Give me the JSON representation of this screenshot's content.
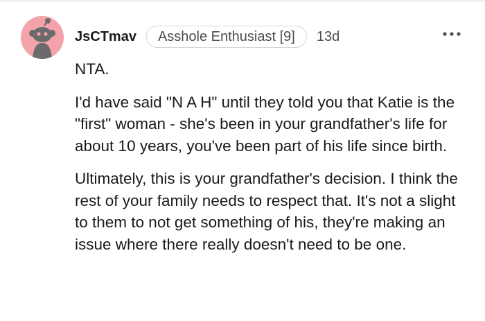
{
  "comment": {
    "username": "JsCTmav",
    "flair": "Asshole Enthusiast [9]",
    "timestamp": "13d",
    "more_label": "•••",
    "avatar_icon": "snoo-avatar-icon",
    "avatar_color": "#f4a3aa",
    "paragraphs": [
      "NTA.",
      "I'd have said \"N A H\" until they told you that Katie is the \"first\" woman - she's been in your grandfather's life for about 10 years, you've been part of his life since birth.",
      "Ultimately, this is your grandfather's decision. I think the rest of your family needs to respect that. It's not a slight to them to not get something of his, they're making an issue where there really doesn't need to be one."
    ]
  }
}
